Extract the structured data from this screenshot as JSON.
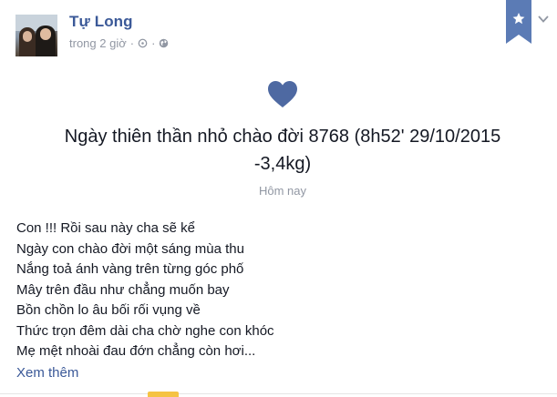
{
  "post": {
    "author": "Tự Long",
    "time": "trong 2 giờ",
    "separator": "·",
    "life_event": {
      "title": "Ngày thiên thần nhỏ chào đời 8768 (8h52' 29/10/2015 -3,4kg)",
      "date": "Hôm nay",
      "icon": "heart-icon",
      "icon_color": "#4e69a2"
    },
    "body_lines": [
      "Con !!! Rồi sau này cha sẽ kể",
      "Ngày con chào đời một sáng mùa thu",
      "Nắng toả ánh vàng trên từng góc phố",
      "Mây trên đầu như chẳng muốn bay",
      "Bồn chồn lo âu bối rối vụng về",
      "Thức trọn đêm dài cha chờ nghe con khóc",
      "Mẹ mệt nhoài đau đớn chẳng còn hơi..."
    ],
    "see_more": "Xem thêm"
  },
  "colors": {
    "link": "#3b5998",
    "meta": "#9197a3",
    "bookmark": "#5b7bb5"
  }
}
